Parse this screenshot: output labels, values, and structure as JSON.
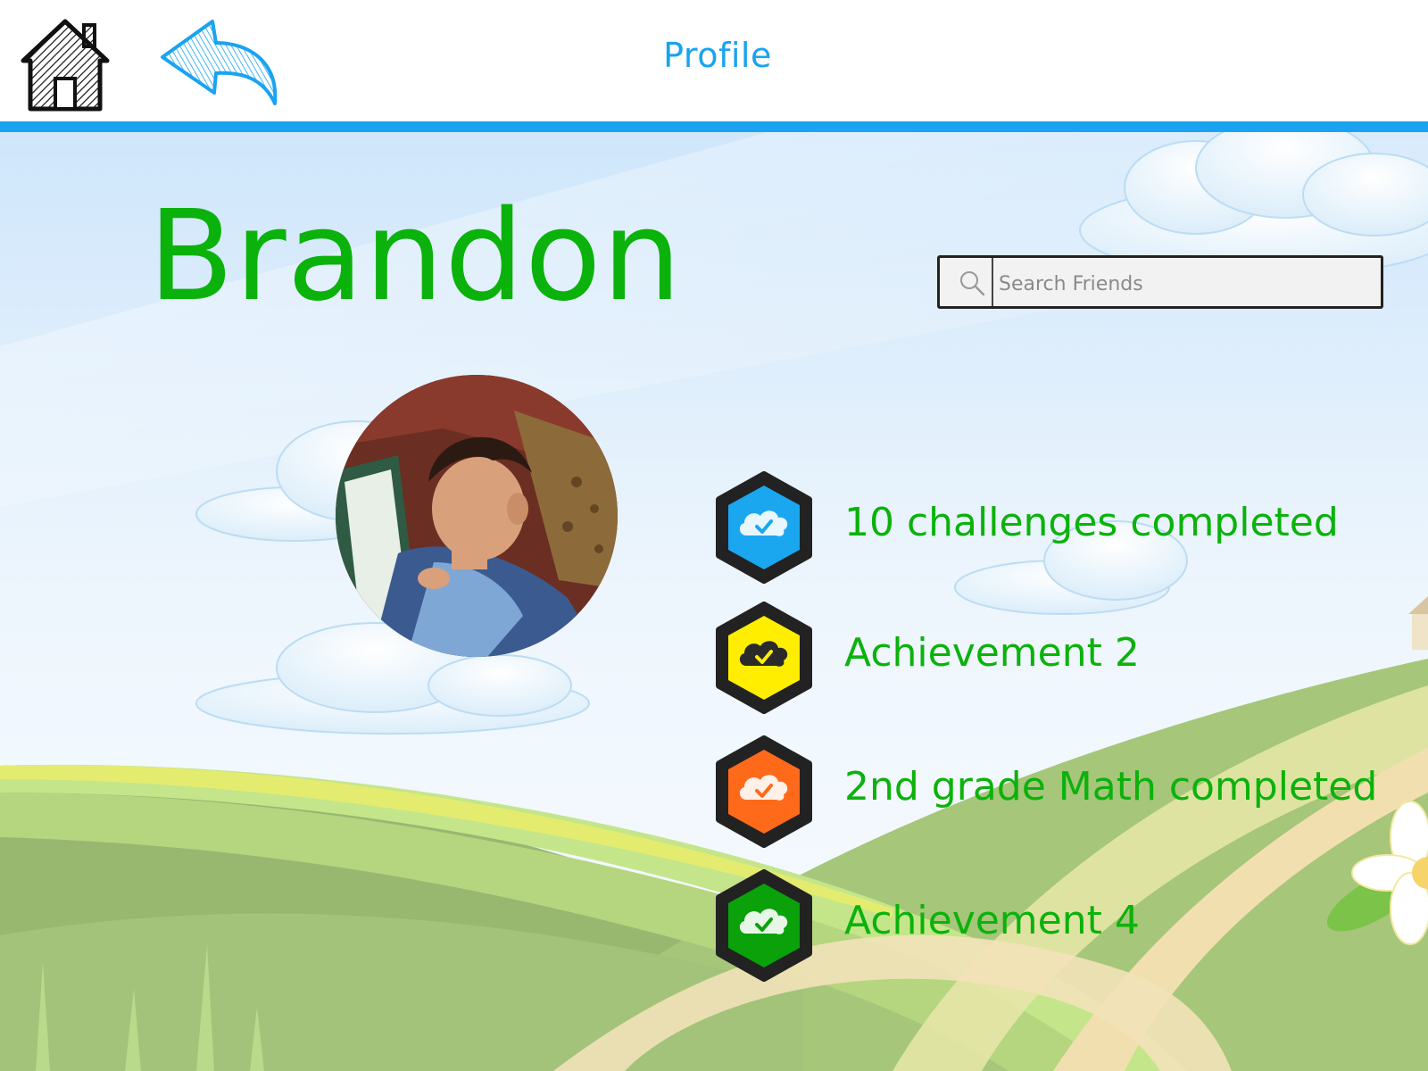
{
  "header": {
    "title": "Profile",
    "home_icon": "home-icon",
    "back_icon": "back-arrow-icon"
  },
  "profile": {
    "name": "Brandon",
    "avatar": "child reading a book"
  },
  "search": {
    "placeholder": "Search Friends",
    "value": ""
  },
  "achievements": [
    {
      "label": "10 challenges completed",
      "color": "#1aa7f0",
      "icon": "cloud-check-icon"
    },
    {
      "label": "Achievement 2",
      "color": "#ffee00",
      "icon": "cloud-check-icon"
    },
    {
      "label": "2nd grade Math completed",
      "color": "#ff6a1a",
      "icon": "cloud-check-icon"
    },
    {
      "label": "Achievement 4",
      "color": "#0aa10a",
      "icon": "cloud-check-icon"
    }
  ],
  "colors": {
    "accent": "#1aa3f0",
    "name_green": "#0bb20b"
  }
}
